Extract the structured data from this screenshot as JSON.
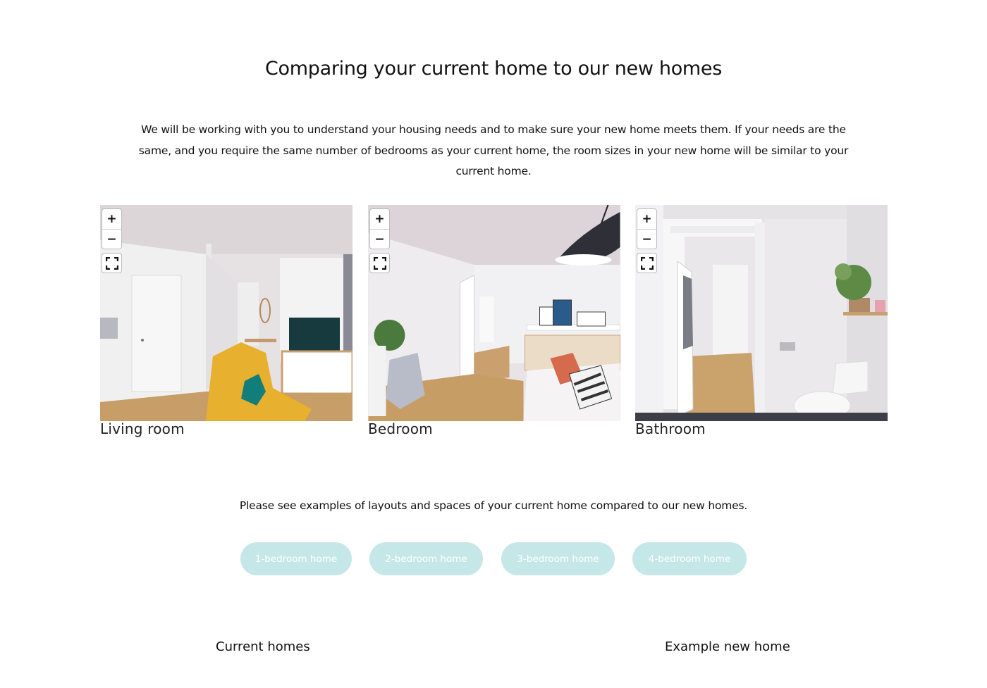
{
  "page": {
    "title": "Comparing your current home to our new homes",
    "intro": "We will be working with you to understand your housing needs and to make sure your new home meets them. If your needs are the same, and you require the same number of bedrooms as your current home, the room sizes in your new home will be similar to your current home.",
    "examples_text": "Please see examples of layouts and spaces of your current home compared to our new homes."
  },
  "viewer_controls": {
    "zoom_in": "+",
    "zoom_out": "−"
  },
  "rooms": [
    {
      "caption": "Living room"
    },
    {
      "caption": "Bedroom"
    },
    {
      "caption": "Bathroom"
    }
  ],
  "buttons": [
    {
      "label": "1-bedroom home"
    },
    {
      "label": "2-bedroom home"
    },
    {
      "label": "3-bedroom home"
    },
    {
      "label": "4-bedroom home"
    }
  ],
  "columns": {
    "current": "Current homes",
    "example": "Example new home"
  },
  "colors": {
    "button_bg": "#c5e7e8",
    "button_text": "#ffffff",
    "text": "#111111"
  },
  "icons": {
    "zoom_in": "plus-icon",
    "zoom_out": "minus-icon",
    "fullscreen": "fullscreen-icon"
  }
}
